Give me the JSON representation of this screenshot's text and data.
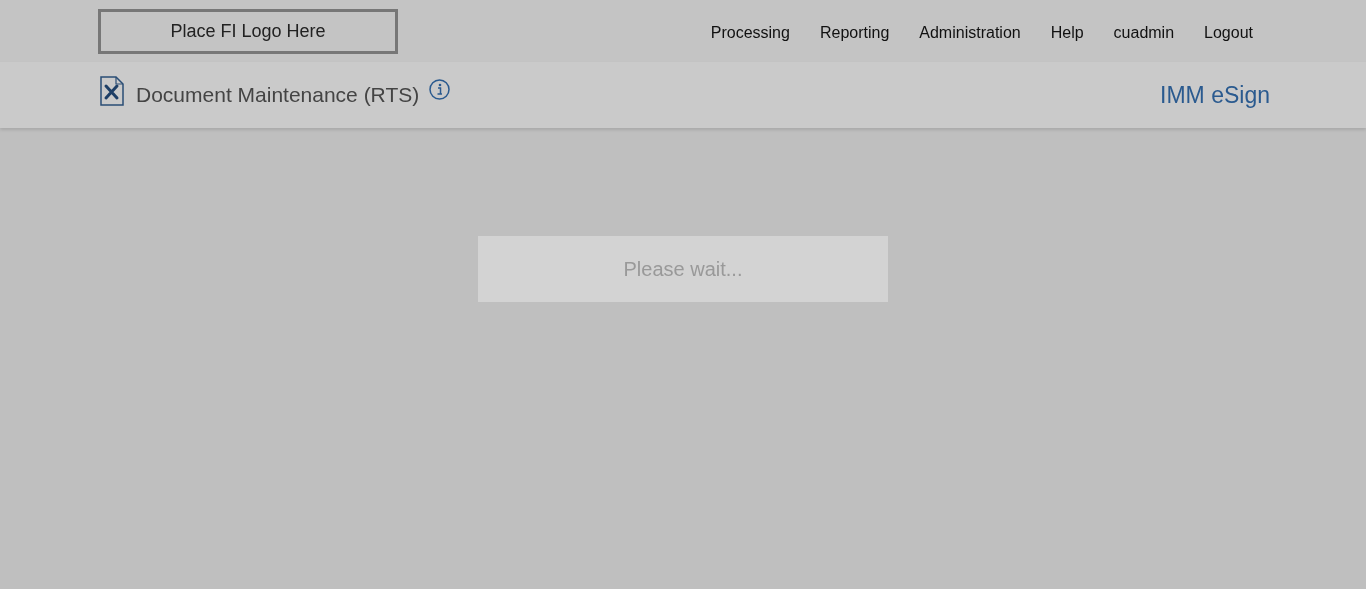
{
  "logo": {
    "text": "Place FI Logo Here"
  },
  "nav": [
    {
      "label": "Processing"
    },
    {
      "label": "Reporting"
    },
    {
      "label": "Administration"
    },
    {
      "label": "Help"
    },
    {
      "label": "cuadmin"
    },
    {
      "label": "Logout"
    }
  ],
  "page_header": {
    "title": "Document Maintenance (RTS)",
    "app_name": "IMM eSign"
  },
  "loading": {
    "message": "Please wait..."
  }
}
